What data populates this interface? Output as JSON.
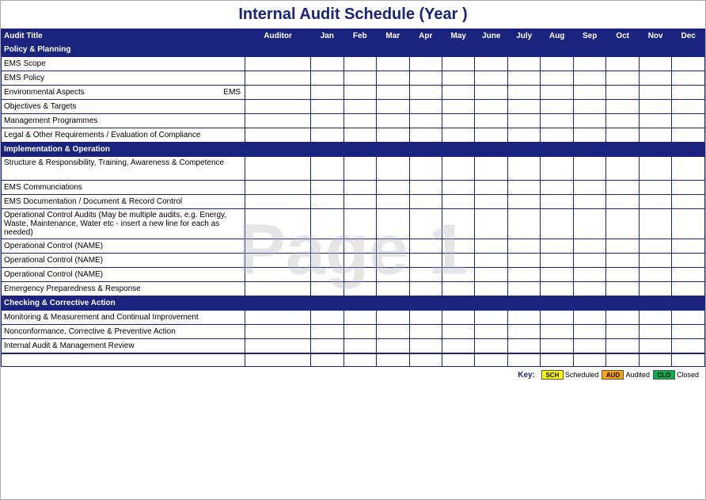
{
  "title": "Internal Audit Schedule (Year          )",
  "watermark": "Page 1",
  "headers": {
    "audit_title": "Audit Title",
    "auditor": "Auditor",
    "months": [
      "Jan",
      "Feb",
      "Mar",
      "Apr",
      "May",
      "June",
      "July",
      "Aug",
      "Sep",
      "Oct",
      "Nov",
      "Dec"
    ]
  },
  "sections": [
    {
      "type": "section",
      "label": "Policy & Planning",
      "rows": [
        {
          "item": "EMS Scope",
          "ems": false
        },
        {
          "item": "EMS Policy",
          "ems": false
        },
        {
          "item": "Environmental Aspects",
          "ems": true
        },
        {
          "item": "Objectives & Targets",
          "ems": false
        },
        {
          "item": "Management Programmes",
          "ems": false
        }
      ]
    },
    {
      "type": "standalone",
      "item": "Legal & Other Requirements / Evaluation of Compliance"
    },
    {
      "type": "section",
      "label": "Implementation & Operation",
      "rows": [
        {
          "item": "Structure & Responsibility, Training, Awareness & Competence",
          "multi": true
        },
        {
          "item": "EMS Communciations"
        },
        {
          "item": "EMS Documentation / Document & Record Control"
        },
        {
          "item": "Operational Control Audits (May be multiple audits, e.g. Energy, Waste, Maintenance, Water etc - insert a new line for each as needed)",
          "multi": true
        },
        {
          "item": "Operational Control (NAME)"
        },
        {
          "item": "Operational Control (NAME)"
        },
        {
          "item": "Operational Control (NAME)"
        },
        {
          "item": "Emergency Preparedness & Response"
        }
      ]
    },
    {
      "type": "section",
      "label": "Checking & Corrective Action",
      "rows": [
        {
          "item": "Monitoring & Measurement and Continual Improvement"
        },
        {
          "item": "Nonconformance, Corrective & Preventive Action"
        },
        {
          "item": "Internal Audit & Management Review"
        }
      ]
    }
  ],
  "key": {
    "label": "Key:",
    "items": [
      {
        "code": "SCH",
        "label": "Scheduled",
        "color": "key-sch"
      },
      {
        "code": "AUD",
        "label": "Audited",
        "color": "key-aud"
      },
      {
        "code": "CLO",
        "label": "Closed",
        "color": "key-cls"
      }
    ]
  }
}
